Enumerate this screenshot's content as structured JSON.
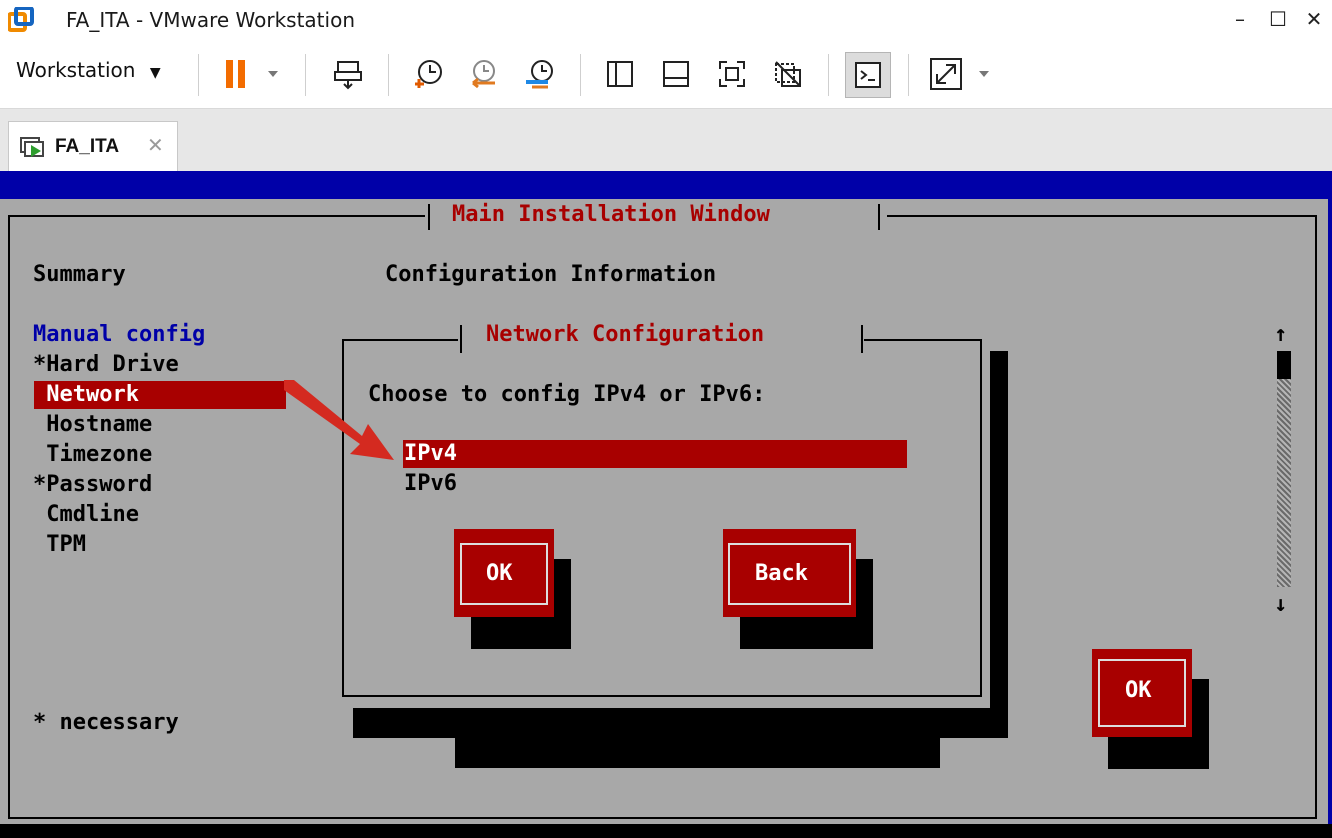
{
  "window": {
    "title": "FA_ITA - VMware Workstation",
    "minimize_glyph": "–",
    "maximize_glyph": "☐",
    "close_glyph": "✕"
  },
  "toolbar": {
    "workstation_menu_label": "Workstation",
    "icons": [
      "pause-icon",
      "send-ctrl-alt-del-icon",
      "snapshot-take-icon",
      "snapshot-revert-icon",
      "snapshot-manager-icon",
      "library-view-icon",
      "thumbnail-view-icon",
      "fullscreen-icon",
      "unity-icon",
      "console-view-icon",
      "stretch-guest-icon"
    ]
  },
  "tabs": [
    {
      "label": "FA_ITA",
      "close_glyph": "✕"
    }
  ],
  "installer": {
    "window_title": "Main Installation Window",
    "summary_heading": "Summary",
    "config_heading": "Configuration Information",
    "menu_heading": "Manual config",
    "menu_items": [
      "*Hard Drive",
      " Network",
      " Hostname",
      " Timezone",
      "*Password",
      " Cmdline",
      " TPM"
    ],
    "selected_menu_item": "Network",
    "necessary_note": "* necessary",
    "ok_label": "OK",
    "scroll_up": "↑",
    "scroll_down": "↓"
  },
  "dialog": {
    "title": "Network Configuration",
    "prompt": "Choose to config IPv4 or IPv6:",
    "options": [
      "IPv4",
      "IPv6"
    ],
    "selected_option": "IPv4",
    "ok_label": "OK",
    "back_label": "Back"
  },
  "colors": {
    "console_background": "#a8a8a8",
    "console_blue": "#0000a8",
    "highlight_red": "#a80000",
    "annotation_arrow": "#d42a20"
  }
}
